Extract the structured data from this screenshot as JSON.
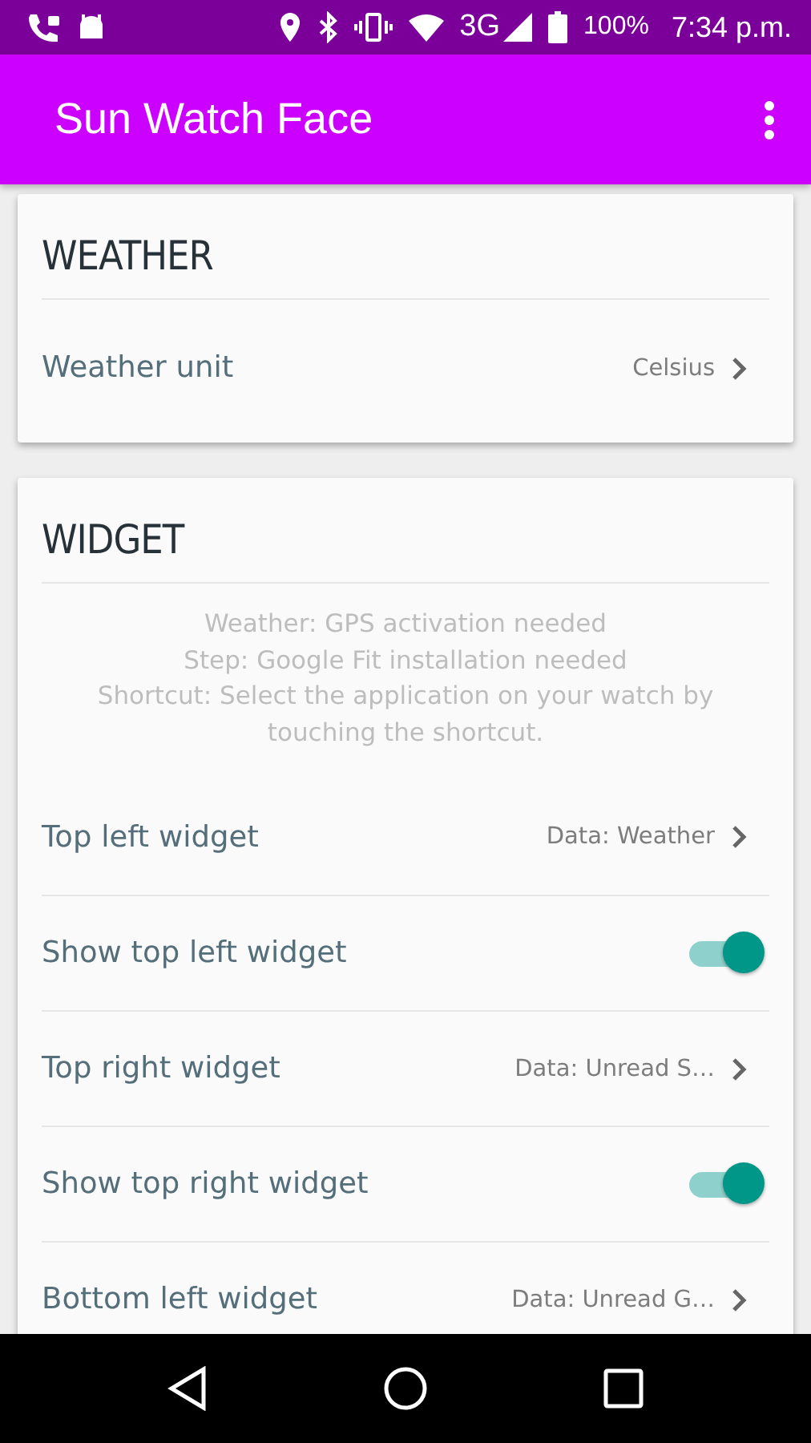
{
  "status_bar": {
    "network": "3G",
    "battery": "100%",
    "time": "7:34 p.m."
  },
  "app_bar": {
    "title": "Sun Watch Face"
  },
  "sections": [
    {
      "title": "WEATHER",
      "rows": [
        {
          "kind": "link",
          "label": "Weather unit",
          "value": "Celsius"
        }
      ]
    },
    {
      "title": "WIDGET",
      "note": [
        "Weather: GPS activation needed",
        "Step: Google Fit installation needed",
        "Shortcut: Select the application on your watch by touching the shortcut."
      ],
      "rows": [
        {
          "kind": "link",
          "label": "Top left widget",
          "value": "Data: Weather"
        },
        {
          "kind": "switch",
          "label": "Show top left widget",
          "on": true
        },
        {
          "kind": "link",
          "label": "Top right widget",
          "value": "Data: Unread S…"
        },
        {
          "kind": "switch",
          "label": "Show top right widget",
          "on": true
        },
        {
          "kind": "link",
          "label": "Bottom left widget",
          "value": "Data: Unread G…"
        }
      ]
    }
  ]
}
